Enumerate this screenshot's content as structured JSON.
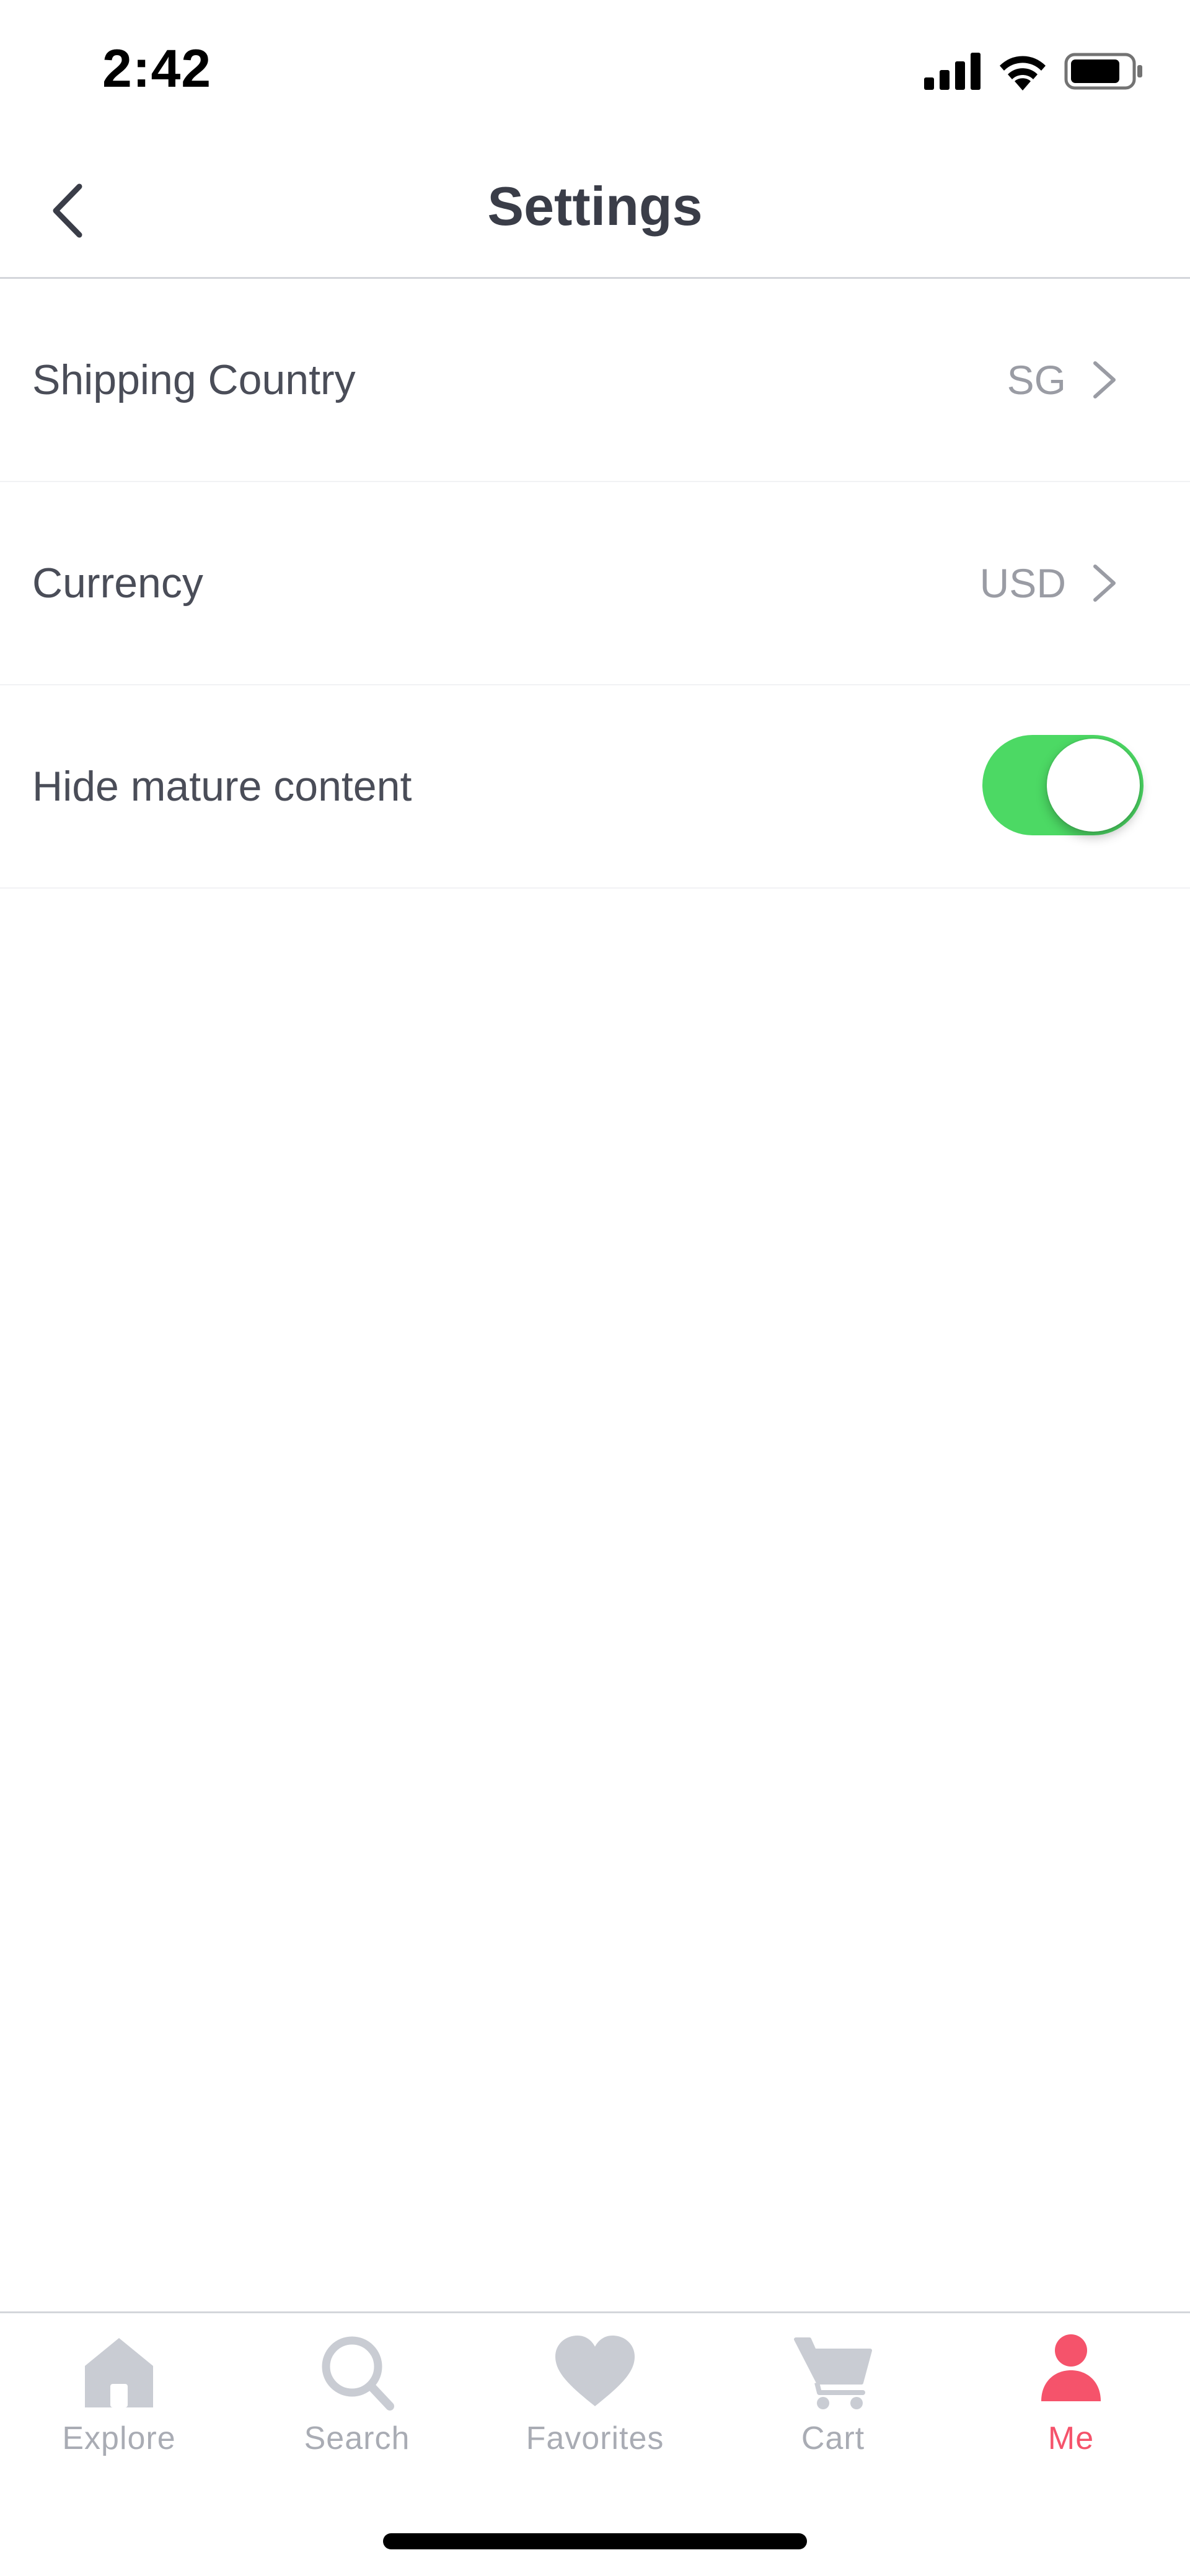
{
  "status_bar": {
    "time": "2:42"
  },
  "header": {
    "title": "Settings",
    "back_icon": "chevron-left-icon"
  },
  "settings": [
    {
      "label": "Shipping Country",
      "value": "SG",
      "type": "link"
    },
    {
      "label": "Currency",
      "value": "USD",
      "type": "link"
    },
    {
      "label": "Hide mature content",
      "type": "toggle",
      "enabled": true
    }
  ],
  "tabs": [
    {
      "label": "Explore",
      "icon": "home-icon",
      "active": false
    },
    {
      "label": "Search",
      "icon": "search-icon",
      "active": false
    },
    {
      "label": "Favorites",
      "icon": "heart-icon",
      "active": false
    },
    {
      "label": "Cart",
      "icon": "cart-icon",
      "active": false
    },
    {
      "label": "Me",
      "icon": "person-icon",
      "active": true
    }
  ],
  "colors": {
    "accent": "#f5536b",
    "toggle_on": "#4cd964",
    "text_primary": "#3a3d48",
    "text_secondary": "#9a9ca4",
    "tab_inactive": "#a9acb4",
    "tab_icon_inactive": "#c9ccd3"
  }
}
